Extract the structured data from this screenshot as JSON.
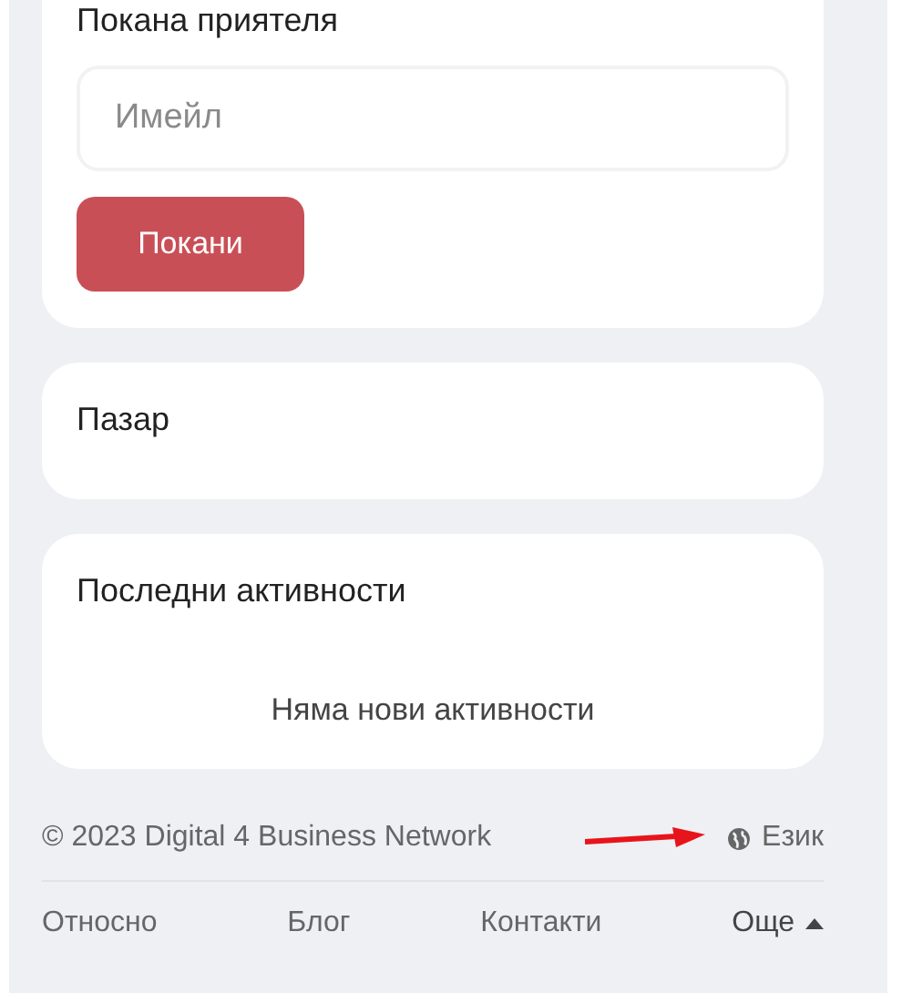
{
  "invite": {
    "title": "Покана приятеля",
    "email": {
      "placeholder": "Имейл"
    },
    "button": "Покани"
  },
  "market": {
    "title": "Пазар"
  },
  "activity": {
    "title": "Последни активности",
    "empty": "Няма нови активности"
  },
  "footer": {
    "copyright": "© 2023 Digital 4 Business Network",
    "language": "Език",
    "links": [
      {
        "label": "Относно",
        "kind": "link"
      },
      {
        "label": "Блог",
        "kind": "link"
      },
      {
        "label": "Контакти",
        "kind": "link"
      },
      {
        "label": "Още",
        "kind": "menu",
        "expanded": true
      }
    ]
  }
}
